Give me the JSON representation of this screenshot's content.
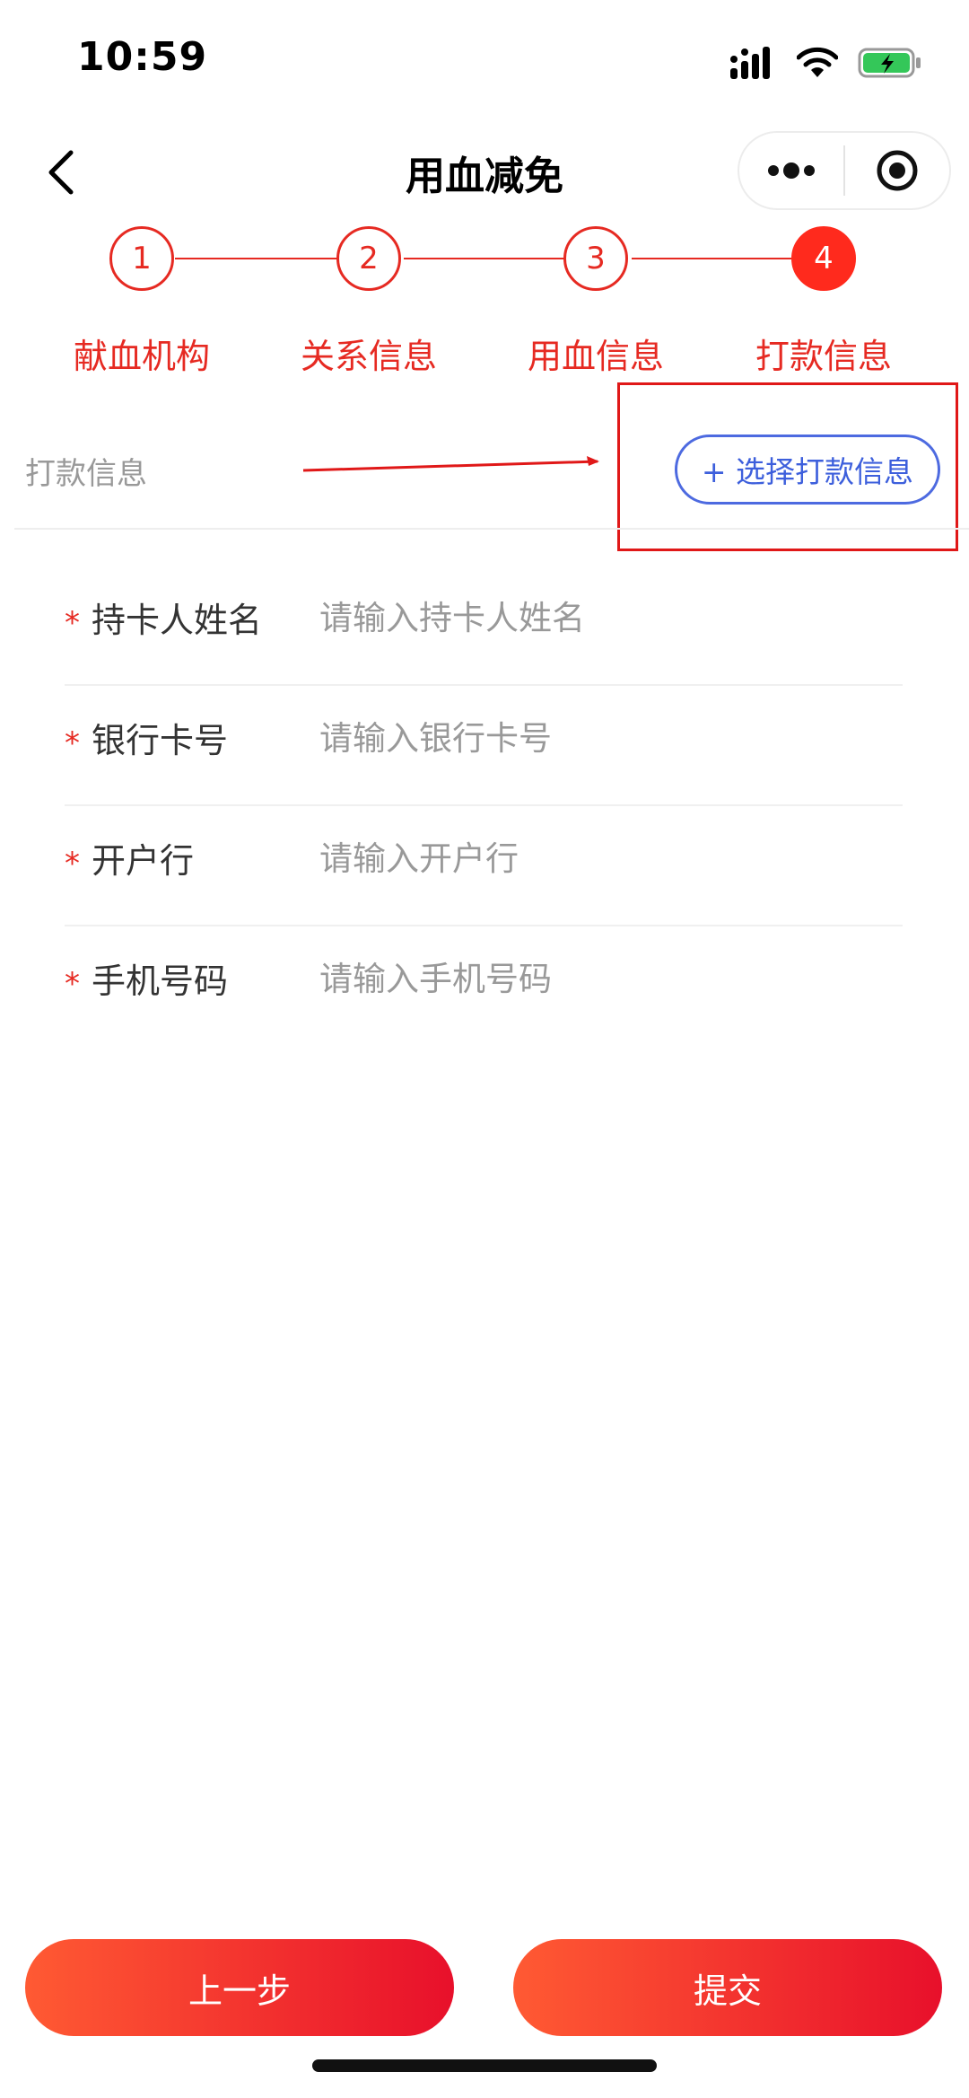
{
  "status_bar": {
    "time": "10:59"
  },
  "nav": {
    "title": "用血减免"
  },
  "steps": [
    {
      "number": "1",
      "label": "献血机构"
    },
    {
      "number": "2",
      "label": "关系信息"
    },
    {
      "number": "3",
      "label": "用血信息"
    },
    {
      "number": "4",
      "label": "打款信息"
    }
  ],
  "payment": {
    "section_label": "打款信息",
    "select_button": "+ 选择打款信息"
  },
  "form": {
    "fields": [
      {
        "label": "持卡人姓名",
        "placeholder": "请输入持卡人姓名",
        "value": ""
      },
      {
        "label": "银行卡号",
        "placeholder": "请输入银行卡号",
        "value": ""
      },
      {
        "label": "开户行",
        "placeholder": "请输入开户行",
        "value": ""
      },
      {
        "label": "手机号码",
        "placeholder": "请输入手机号码",
        "value": ""
      }
    ],
    "required_mark": "*"
  },
  "buttons": {
    "prev": "上一步",
    "submit": "提交"
  },
  "colors": {
    "accent": "#e62a22",
    "link_blue": "#3d5fdc",
    "gradient_start": "#ff5a33",
    "gradient_end": "#e8102b"
  },
  "icons": [
    "signal-icon",
    "wifi-icon",
    "battery-charging-icon",
    "back-chevron-icon",
    "more-dots-icon",
    "close-target-icon"
  ]
}
